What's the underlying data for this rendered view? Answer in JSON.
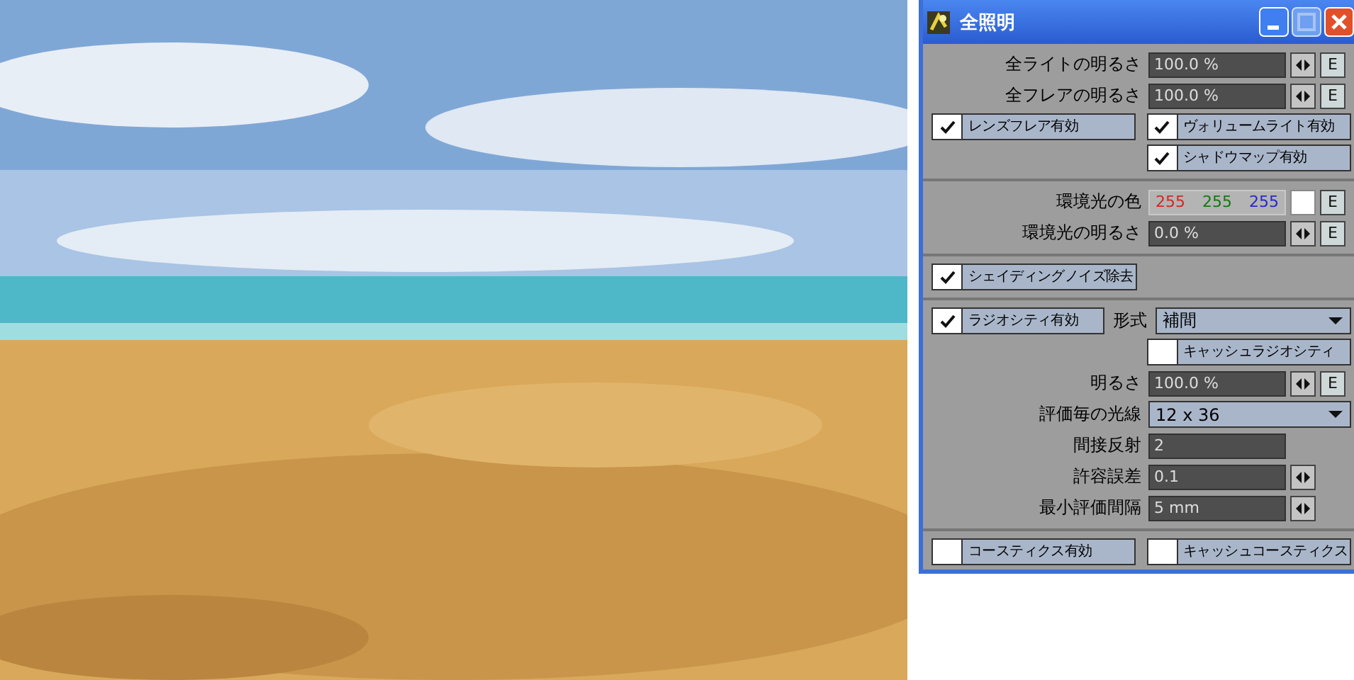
{
  "window": {
    "title": "全照明"
  },
  "sections": [
    {
      "rows": [
        {
          "kind": "value",
          "label": "全ライトの明るさ",
          "value": "100.0 %",
          "spinner": true,
          "envelope": "E"
        },
        {
          "kind": "value",
          "label": "全フレアの明るさ",
          "value": "100.0 %",
          "spinner": true,
          "envelope": "E"
        },
        {
          "kind": "checks",
          "left": {
            "label": "レンズフレア有効",
            "checked": true
          },
          "right": {
            "label": "ヴォリュームライト有効",
            "checked": true
          }
        },
        {
          "kind": "checks",
          "right": {
            "label": "シャドウマップ有効",
            "checked": true
          }
        }
      ]
    },
    {
      "rows": [
        {
          "kind": "color",
          "label": "環境光の色",
          "values": [
            {
              "text": "255",
              "color": "#d02828"
            },
            {
              "text": "255",
              "color": "#107a10"
            },
            {
              "text": "255",
              "color": "#2828c8"
            }
          ],
          "color": "#ffffff",
          "envelope": "E"
        },
        {
          "kind": "value",
          "label": "環境光の明るさ",
          "value": "0.0 %",
          "spinner": true,
          "envelope": "E"
        }
      ]
    },
    {
      "rows": [
        {
          "kind": "checks",
          "left": {
            "label": "シェイディングノイズ除去",
            "checked": true
          }
        }
      ]
    },
    {
      "rows": [
        {
          "kind": "checkdrop",
          "check": {
            "label": "ラジオシティ有効",
            "checked": true
          },
          "label": "形式",
          "value": "補間"
        },
        {
          "kind": "checks",
          "right": {
            "label": "キャッシュラジオシティ",
            "checked": false
          }
        },
        {
          "kind": "value",
          "label": "明るさ",
          "value": "100.0 %",
          "spinner": true,
          "envelope": "E"
        },
        {
          "kind": "dropdown",
          "label": "評価毎の光線",
          "value": "12 x 36"
        },
        {
          "kind": "value",
          "label": "間接反射",
          "value": "2",
          "spinner": false
        },
        {
          "kind": "value",
          "label": "許容誤差",
          "value": "0.1",
          "spinner": true
        },
        {
          "kind": "value",
          "label": "最小評価間隔",
          "value": "5 mm",
          "spinner": true
        }
      ]
    },
    {
      "rows": [
        {
          "kind": "checks",
          "left": {
            "label": "コースティクス有効",
            "checked": false
          },
          "right": {
            "label": "キャッシュコースティクス",
            "checked": false
          }
        }
      ]
    }
  ]
}
